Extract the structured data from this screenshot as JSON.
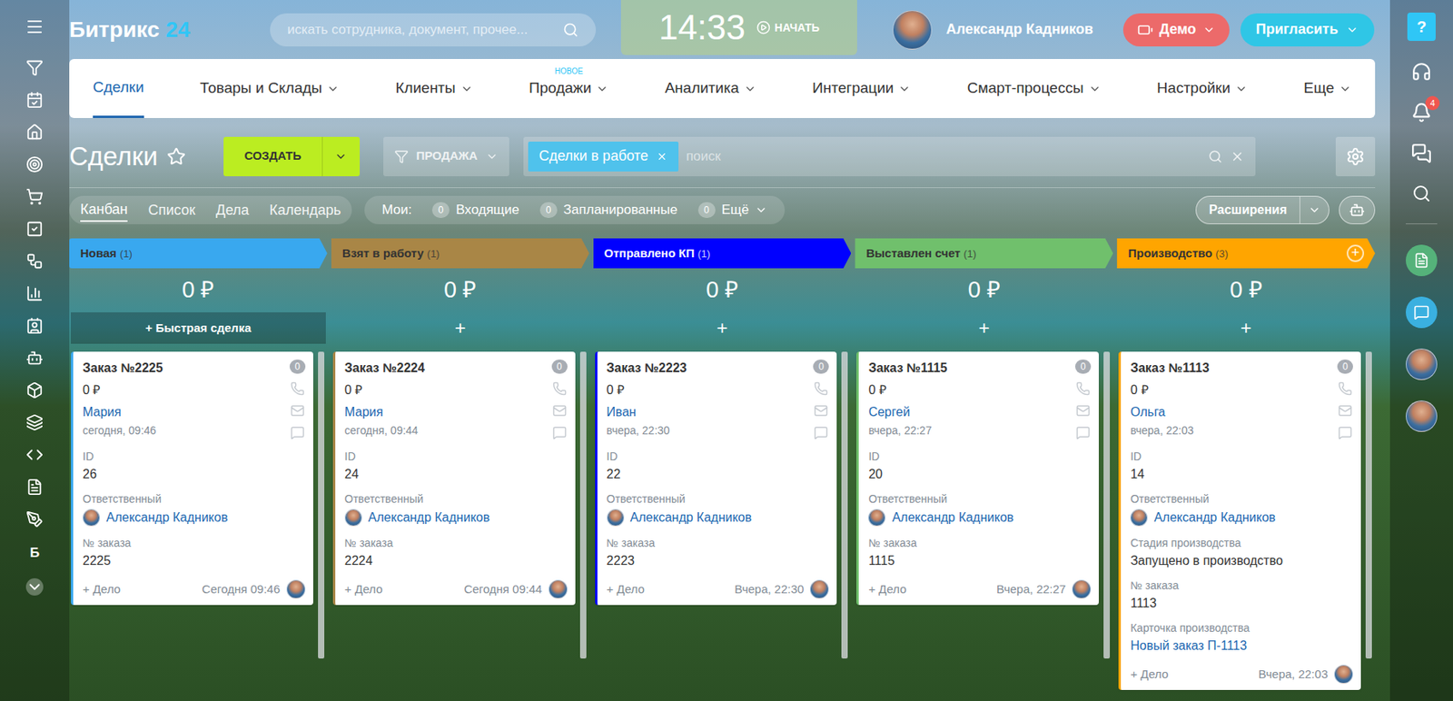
{
  "header": {
    "logo": {
      "name": "Битрикс",
      "suffix": "24"
    },
    "search_placeholder": "искать сотрудника, документ, прочее...",
    "clock": "14:33",
    "start": "НАЧАТЬ",
    "user": "Александр Кадников",
    "demo": "Демо",
    "invite": "Пригласить",
    "help": "?"
  },
  "nav": [
    {
      "label": "Сделки",
      "selected": true,
      "dropdown": false
    },
    {
      "label": "Товары и Склады",
      "selected": false,
      "dropdown": true
    },
    {
      "label": "Клиенты",
      "selected": false,
      "dropdown": true
    },
    {
      "label": "Продажи",
      "selected": false,
      "dropdown": true,
      "badge": "НОВОЕ"
    },
    {
      "label": "Аналитика",
      "selected": false,
      "dropdown": true
    },
    {
      "label": "Интеграции",
      "selected": false,
      "dropdown": true
    },
    {
      "label": "Смарт-процессы",
      "selected": false,
      "dropdown": true
    },
    {
      "label": "Настройки",
      "selected": false,
      "dropdown": true
    },
    {
      "label": "Еще",
      "selected": false,
      "dropdown": true
    }
  ],
  "page": {
    "title": "Сделки",
    "create": "СОЗДАТЬ",
    "category": "ПРОДАЖА",
    "filter_tag": "Сделки в работе",
    "filter_placeholder": "поиск"
  },
  "views": [
    {
      "label": "Канбан",
      "selected": true
    },
    {
      "label": "Список",
      "selected": false
    },
    {
      "label": "Дела",
      "selected": false
    },
    {
      "label": "Календарь",
      "selected": false
    }
  ],
  "counters": {
    "label": "Мои:",
    "items": [
      {
        "count": "0",
        "label": "Входящие",
        "dropdown": false
      },
      {
        "count": "0",
        "label": "Запланированные",
        "dropdown": false
      },
      {
        "count": "0",
        "label": "Ещё",
        "dropdown": true
      }
    ]
  },
  "extensions": "Расширения",
  "notifications": "4",
  "sidebar_letter": "Б",
  "stages": [
    {
      "name": "Новая",
      "count": "(1)",
      "color": "#39a8ef",
      "sum": "0 ₽",
      "add": "+ Быстрая сделка",
      "add_stage": null,
      "cards": [
        {
          "title": "Заказ №2225",
          "sum": "0 ₽",
          "contact": "Мария",
          "date": "сегодня, 09:46",
          "counter": "0",
          "fields": [
            {
              "label": "ID",
              "value": "26",
              "kind": "text"
            },
            {
              "label": "Ответственный",
              "value": "Александр Кадников",
              "kind": "user"
            },
            {
              "label": "№ заказа",
              "value": "2225",
              "kind": "text"
            }
          ],
          "action": "+ Дело",
          "time": "Сегодня 09:46"
        }
      ]
    },
    {
      "name": "Взят в работу",
      "count": "(1)",
      "color": "#a98646",
      "sum": "0 ₽",
      "add": "+",
      "add_stage": null,
      "cards": [
        {
          "title": "Заказ №2224",
          "sum": "0 ₽",
          "contact": "Мария",
          "date": "сегодня, 09:44",
          "counter": "0",
          "fields": [
            {
              "label": "ID",
              "value": "24",
              "kind": "text"
            },
            {
              "label": "Ответственный",
              "value": "Александр Кадников",
              "kind": "user"
            },
            {
              "label": "№ заказа",
              "value": "2224",
              "kind": "text"
            }
          ],
          "action": "+ Дело",
          "time": "Сегодня 09:44"
        }
      ]
    },
    {
      "name": "Отправлено КП",
      "count": "(1)",
      "color": "#0000ff",
      "sum": "0 ₽",
      "add": "+",
      "add_stage": null,
      "cards": [
        {
          "title": "Заказ №2223",
          "sum": "0 ₽",
          "contact": "Иван",
          "date": "вчера, 22:30",
          "counter": "0",
          "fields": [
            {
              "label": "ID",
              "value": "22",
              "kind": "text"
            },
            {
              "label": "Ответственный",
              "value": "Александр Кадников",
              "kind": "user"
            },
            {
              "label": "№ заказа",
              "value": "2223",
              "kind": "text"
            }
          ],
          "action": "+ Дело",
          "time": "Вчера, 22:30"
        }
      ]
    },
    {
      "name": "Выставлен счет",
      "count": "(1)",
      "color": "#70c06c",
      "sum": "0 ₽",
      "add": "+",
      "add_stage": null,
      "cards": [
        {
          "title": "Заказ №1115",
          "sum": "0 ₽",
          "contact": "Сергей",
          "date": "вчера, 22:27",
          "counter": "0",
          "fields": [
            {
              "label": "ID",
              "value": "20",
              "kind": "text"
            },
            {
              "label": "Ответственный",
              "value": "Александр Кадников",
              "kind": "user"
            },
            {
              "label": "№ заказа",
              "value": "1115",
              "kind": "text"
            }
          ],
          "action": "+ Дело",
          "time": "Вчера, 22:27"
        }
      ]
    },
    {
      "name": "Производство",
      "count": "(3)",
      "color": "#ffa500",
      "sum": "0 ₽",
      "add": "+",
      "add_stage": "+",
      "cards": [
        {
          "title": "Заказ №1113",
          "sum": "0 ₽",
          "contact": "Ольга",
          "date": "вчера, 22:03",
          "counter": "0",
          "fields": [
            {
              "label": "ID",
              "value": "14",
              "kind": "text"
            },
            {
              "label": "Ответственный",
              "value": "Александр Кадников",
              "kind": "user"
            },
            {
              "label": "Стадия производства",
              "value": "Запущено в производство",
              "kind": "text"
            },
            {
              "label": "№ заказа",
              "value": "1113",
              "kind": "text"
            },
            {
              "label": "Карточка производства",
              "value": "Новый заказ П-1113",
              "kind": "link"
            }
          ],
          "action": "+ Дело",
          "time": "Вчера, 22:03"
        }
      ]
    }
  ]
}
